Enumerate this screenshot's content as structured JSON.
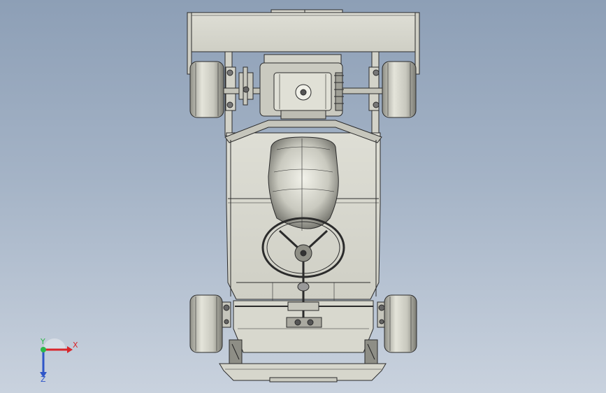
{
  "viewport": {
    "background_top": "#8d9fb6",
    "background_bottom": "#c9d2de"
  },
  "model": {
    "subject": "go-kart-assembly",
    "view": "top",
    "body_color": "#d9d9cf",
    "edge_color": "#2b2b2b"
  },
  "triad": {
    "x_label": "X",
    "y_label": "Y",
    "z_label": "Z",
    "x_color": "#d8262b",
    "y_color": "#2db84a",
    "z_color": "#2f56c8"
  }
}
